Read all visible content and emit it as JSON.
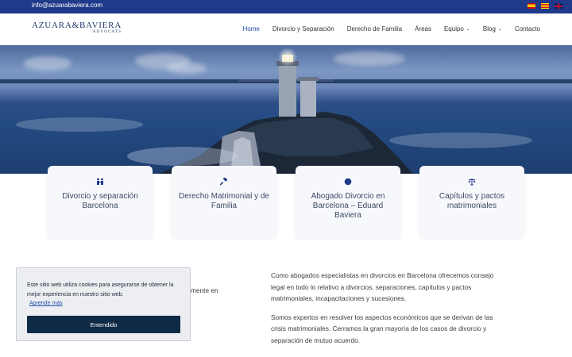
{
  "topbar": {
    "email": "info@azuarabaviera.com",
    "flags": [
      "flag-es-icon",
      "flag-catalonia-icon",
      "flag-uk-icon"
    ]
  },
  "header": {
    "logo_main": "AZUARA&BAVIERA",
    "logo_sub": "ADVOCATS",
    "nav": [
      {
        "label": "Home",
        "active": true
      },
      {
        "label": "Divorcio y Separación"
      },
      {
        "label": "Derecho de Familia"
      },
      {
        "label": "Áreas"
      },
      {
        "label": "Equipo",
        "dropdown": true
      },
      {
        "label": "Blog",
        "dropdown": true
      },
      {
        "label": "Contacto"
      }
    ]
  },
  "cards": [
    {
      "icon": "family-icon",
      "title": "Divorcio y separación Barcelona"
    },
    {
      "icon": "gavel-icon",
      "title": "Derecho Matrimonial y de Familia"
    },
    {
      "icon": "globe-icon",
      "title": "Abogado Divorcio en Barcelona – Eduard Baviera"
    },
    {
      "icon": "scales-icon",
      "title": "Capítulos y pactos matrimoniales"
    }
  ],
  "content": {
    "p1": "Como abogados especialistas en divorcios en Barcelona ofrecemos consejo legal en todo lo relativo a divorcios, separaciones, capítulos y pactos matrimoniales, incapacitaciones y sucesiones.",
    "p2": "Somos expertos en resolver los aspectos económicos que se derivan de las crisis matrimoniales. Cerramos la gran mayoría de los casos de divorcio y separación de mutuo acuerdo.",
    "partial": "mente en"
  },
  "cookie": {
    "message": "Este sitio web utiliza cookies para asegurarse de obtener la mejor experiencia en nuestro sitio web.",
    "link": "Aprende más",
    "button": "Entendido"
  },
  "colors": {
    "topbar": "#1f3a8a",
    "nav_active": "#1f4ea8",
    "button": "#0e2a45",
    "icon": "#1f3a8a"
  }
}
